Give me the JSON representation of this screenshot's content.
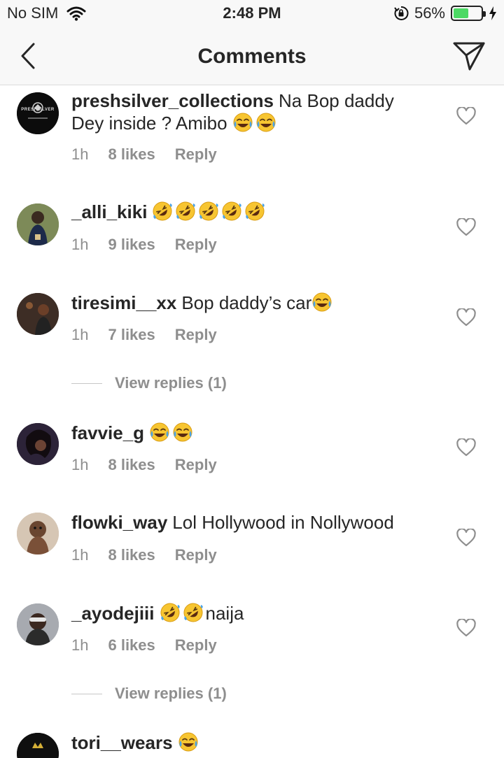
{
  "status_bar": {
    "carrier": "No SIM",
    "time": "2:48 PM",
    "battery_percent": "56%",
    "battery_level": 0.56,
    "icons": [
      "wifi-icon",
      "orientation-lock-icon",
      "battery-icon",
      "charging-bolt-icon"
    ]
  },
  "header": {
    "title": "Comments",
    "back_icon": "chevron-left-icon",
    "send_icon": "paper-plane-icon"
  },
  "comments": [
    {
      "username": "preshsilver_collections",
      "text_line1": "Na Bop daddy",
      "text_line2": "Dey inside ? Amibo",
      "emojis_tears_of_joy": 2,
      "time": "1h",
      "likes": "8 likes",
      "reply": "Reply",
      "avatar_text": "PRESHSILVER"
    },
    {
      "username": "_alli_kiki",
      "text": "",
      "emojis_rofl": 5,
      "time": "1h",
      "likes": "9 likes",
      "reply": "Reply"
    },
    {
      "username": "tiresimi__xx",
      "text": "Bop daddy’s car",
      "emojis_tears_of_joy": 1,
      "time": "1h",
      "likes": "7 likes",
      "reply": "Reply",
      "view_replies": "View replies (1)"
    },
    {
      "username": "favvie_g",
      "text": "",
      "emojis_tears_of_joy": 2,
      "time": "1h",
      "likes": "8 likes",
      "reply": "Reply"
    },
    {
      "username": "flowki_way",
      "text": "Lol Hollywood in Nollywood",
      "time": "1h",
      "likes": "8 likes",
      "reply": "Reply"
    },
    {
      "username": "_ayodejiii",
      "text": "naija",
      "emojis_rofl": 2,
      "time": "1h",
      "likes": "6 likes",
      "reply": "Reply",
      "view_replies": "View replies (1)"
    },
    {
      "username": "tori__wears",
      "emojis_tears_of_joy": 1
    }
  ]
}
